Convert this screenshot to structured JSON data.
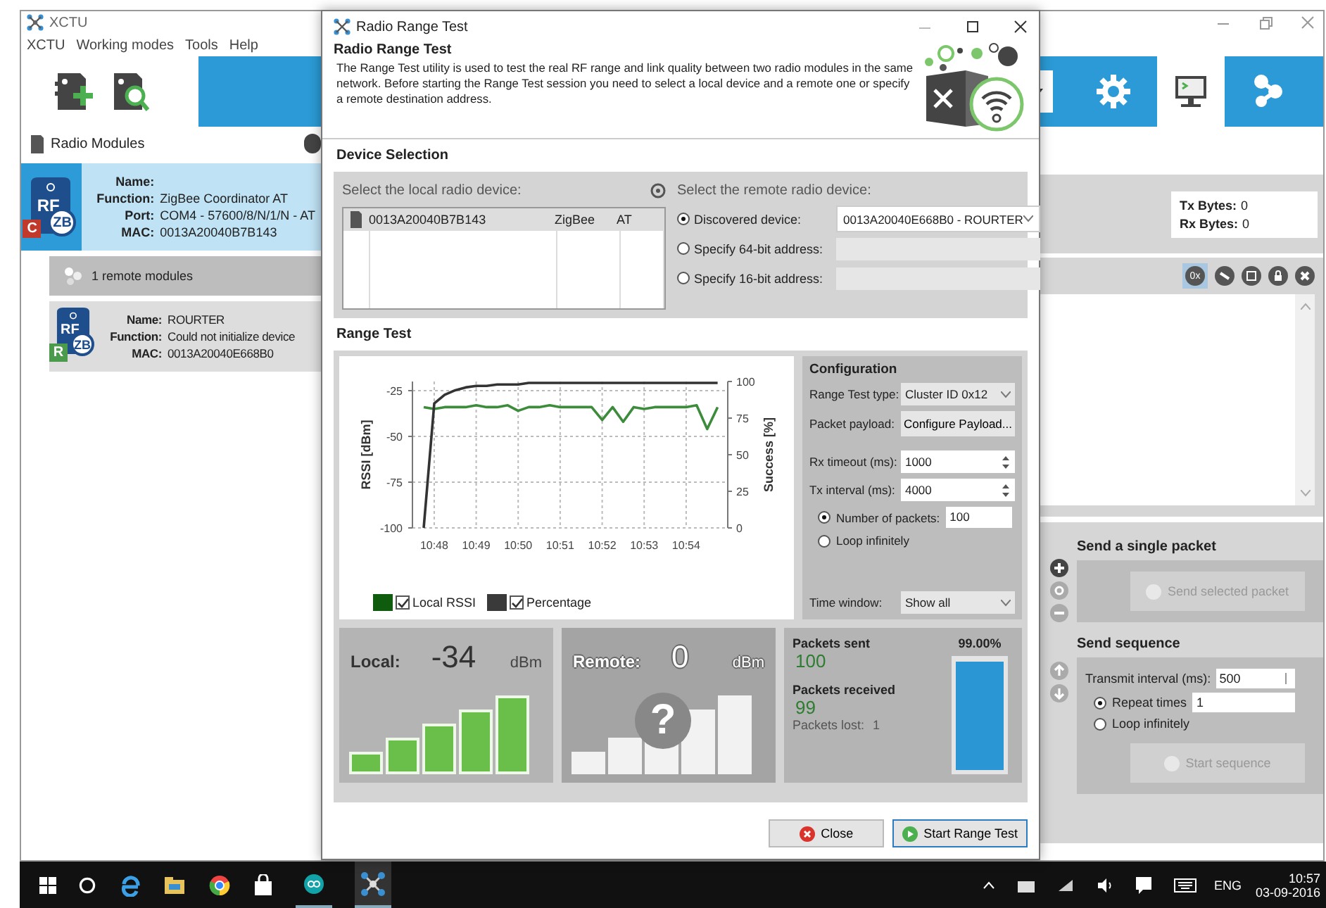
{
  "main_window": {
    "title": "XCTU",
    "menu": [
      "XCTU",
      "Working modes",
      "Tools",
      "Help"
    ],
    "modules_title": "Radio Modules",
    "local_module": {
      "selected": true,
      "role": "C",
      "chip": "RF",
      "protocol": "ZB",
      "fields": [
        {
          "label": "Name:"
        },
        {
          "label": "Function:",
          "value": "ZigBee Coordinator AT"
        },
        {
          "label": "Port:",
          "value": "COM4 - 57600/8/N/1/N - AT"
        },
        {
          "label": "MAC:",
          "value": "0013A20040B7B143"
        }
      ]
    },
    "remote_header": "1 remote modules",
    "remote_modules": [
      {
        "selected": false,
        "role": "R",
        "chip": "RF",
        "protocol": "ZB",
        "fields": [
          {
            "label": "Name:",
            "value": "ROURTER"
          },
          {
            "label": "Function:",
            "value": "Could not initialize device"
          },
          {
            "label": "MAC:",
            "value": "0013A20040E668B0"
          }
        ]
      }
    ],
    "counters": [
      {
        "label": "Tx Bytes:",
        "value": "0"
      },
      {
        "label": "Rx Bytes:",
        "value": "0"
      }
    ],
    "hex_toggle": {
      "text": "0x",
      "selected": true
    },
    "send_single": {
      "title": "Send a single packet",
      "button": "Send selected packet",
      "disabled": true
    },
    "send_sequence": {
      "title": "Send sequence",
      "interval_label": "Transmit interval (ms):",
      "interval": "500",
      "options": [
        {
          "label": "Repeat times",
          "selected": true,
          "value": "1"
        },
        {
          "label": "Loop infinitely",
          "selected": false
        }
      ],
      "button": "Start sequence",
      "disabled": true
    }
  },
  "dialog": {
    "title": "Radio Range Test",
    "heading": "Radio Range Test",
    "description": "The Range Test utility is used to test the real RF range and link quality between two radio modules in the same network. Before starting the Range Test session you need to select a local device and a remote one or specify a remote destination address.",
    "device_selection": {
      "title": "Device Selection",
      "local_label": "Select the local radio device:",
      "local_devices": [
        {
          "mac": "0013A20040B7B143",
          "protocol": "ZigBee",
          "mode": "AT",
          "selected": true
        }
      ],
      "remote_label": "Select the remote radio device:",
      "remote_options": [
        {
          "kind": "dropdown",
          "label": "Discovered device:",
          "value": "0013A20040E668B0 - ROURTER",
          "selected": true
        },
        {
          "kind": "field",
          "label": "Specify 64-bit address:",
          "selected": false
        },
        {
          "kind": "field",
          "label": "Specify 16-bit address:",
          "selected": false
        }
      ]
    },
    "range_test": {
      "title": "Range Test",
      "chart_data": {
        "type": "line",
        "grid": true,
        "ylabel": "RSSI [dBm]",
        "y2label": "Success [%]",
        "ylim": [
          -100,
          -20
        ],
        "y2lim": [
          0,
          100
        ],
        "categories": [
          null,
          "10:48",
          null,
          null,
          null,
          "10:49",
          null,
          null,
          null,
          "10:50",
          null,
          null,
          null,
          "10:51",
          null,
          null,
          null,
          "10:52",
          null,
          null,
          null,
          "10:53",
          null,
          null,
          null,
          "10:54",
          null,
          null,
          null
        ],
        "yticks": [
          -25,
          -50,
          -75,
          -100
        ],
        "y2ticks": [
          100,
          75,
          50,
          25,
          0
        ],
        "series": [
          {
            "name": "Local RSSI",
            "color": "#3c8c3c",
            "values": [
              -34,
              -35,
              -34,
              -34,
              -34,
              -33,
              -34,
              -34,
              -33,
              -36,
              -34,
              -34,
              -33,
              -34,
              -34,
              -34,
              -34,
              -41,
              -34,
              -42,
              -34,
              -35,
              -34,
              -34,
              -34,
              -34,
              -33,
              -46,
              -34
            ]
          },
          {
            "name": "Percentage",
            "color": "#333333",
            "axis": "y2",
            "values": [
              0,
              85,
              91,
              94,
              96,
              97,
              97,
              98,
              98,
              98,
              99,
              99,
              99,
              99,
              99,
              99,
              99,
              99,
              99,
              99,
              99,
              99,
              99,
              99,
              99,
              99,
              99,
              99,
              99
            ]
          }
        ]
      },
      "legend": [
        {
          "color": "#0f5c0f",
          "checked": true
        },
        {
          "color": "#3a3a3a",
          "checked": true
        }
      ],
      "configuration": {
        "title": "Configuration",
        "rows": [
          {
            "kind": "dropdown",
            "label": "Range Test type:",
            "value": "Cluster ID 0x12"
          },
          {
            "kind": "button",
            "label": "Packet payload:",
            "value": "Configure Payload..."
          },
          {
            "kind": "spinner",
            "label": "Rx timeout (ms):",
            "value": "1000"
          },
          {
            "kind": "spinner",
            "label": "Tx interval (ms):",
            "value": "4000"
          }
        ],
        "modes": [
          {
            "label": "Number of packets:",
            "selected": true,
            "value": "100"
          },
          {
            "label": "Loop infinitely",
            "selected": false
          }
        ],
        "time_window_label": "Time window:",
        "time_window": "Show all"
      },
      "meters": [
        {
          "label": "Local:",
          "value": "-34",
          "unit": "dBm",
          "disabled": false
        },
        {
          "label": "Remote:",
          "value": "0",
          "unit": "dBm",
          "disabled": true,
          "unknown_mark": "?"
        }
      ],
      "packets": {
        "sent_label": "Packets sent",
        "sent": "100",
        "received_label": "Packets received",
        "received": "99",
        "lost_label": "Packets lost:",
        "lost": "1",
        "percent": "99.00%",
        "level": 0.99
      }
    },
    "buttons": [
      {
        "kind": "close",
        "label": "Close"
      },
      {
        "kind": "start",
        "label": "Start Range Test"
      }
    ]
  },
  "taskbar": {
    "language": "ENG",
    "time": "10:57",
    "date": "03-09-2016"
  }
}
